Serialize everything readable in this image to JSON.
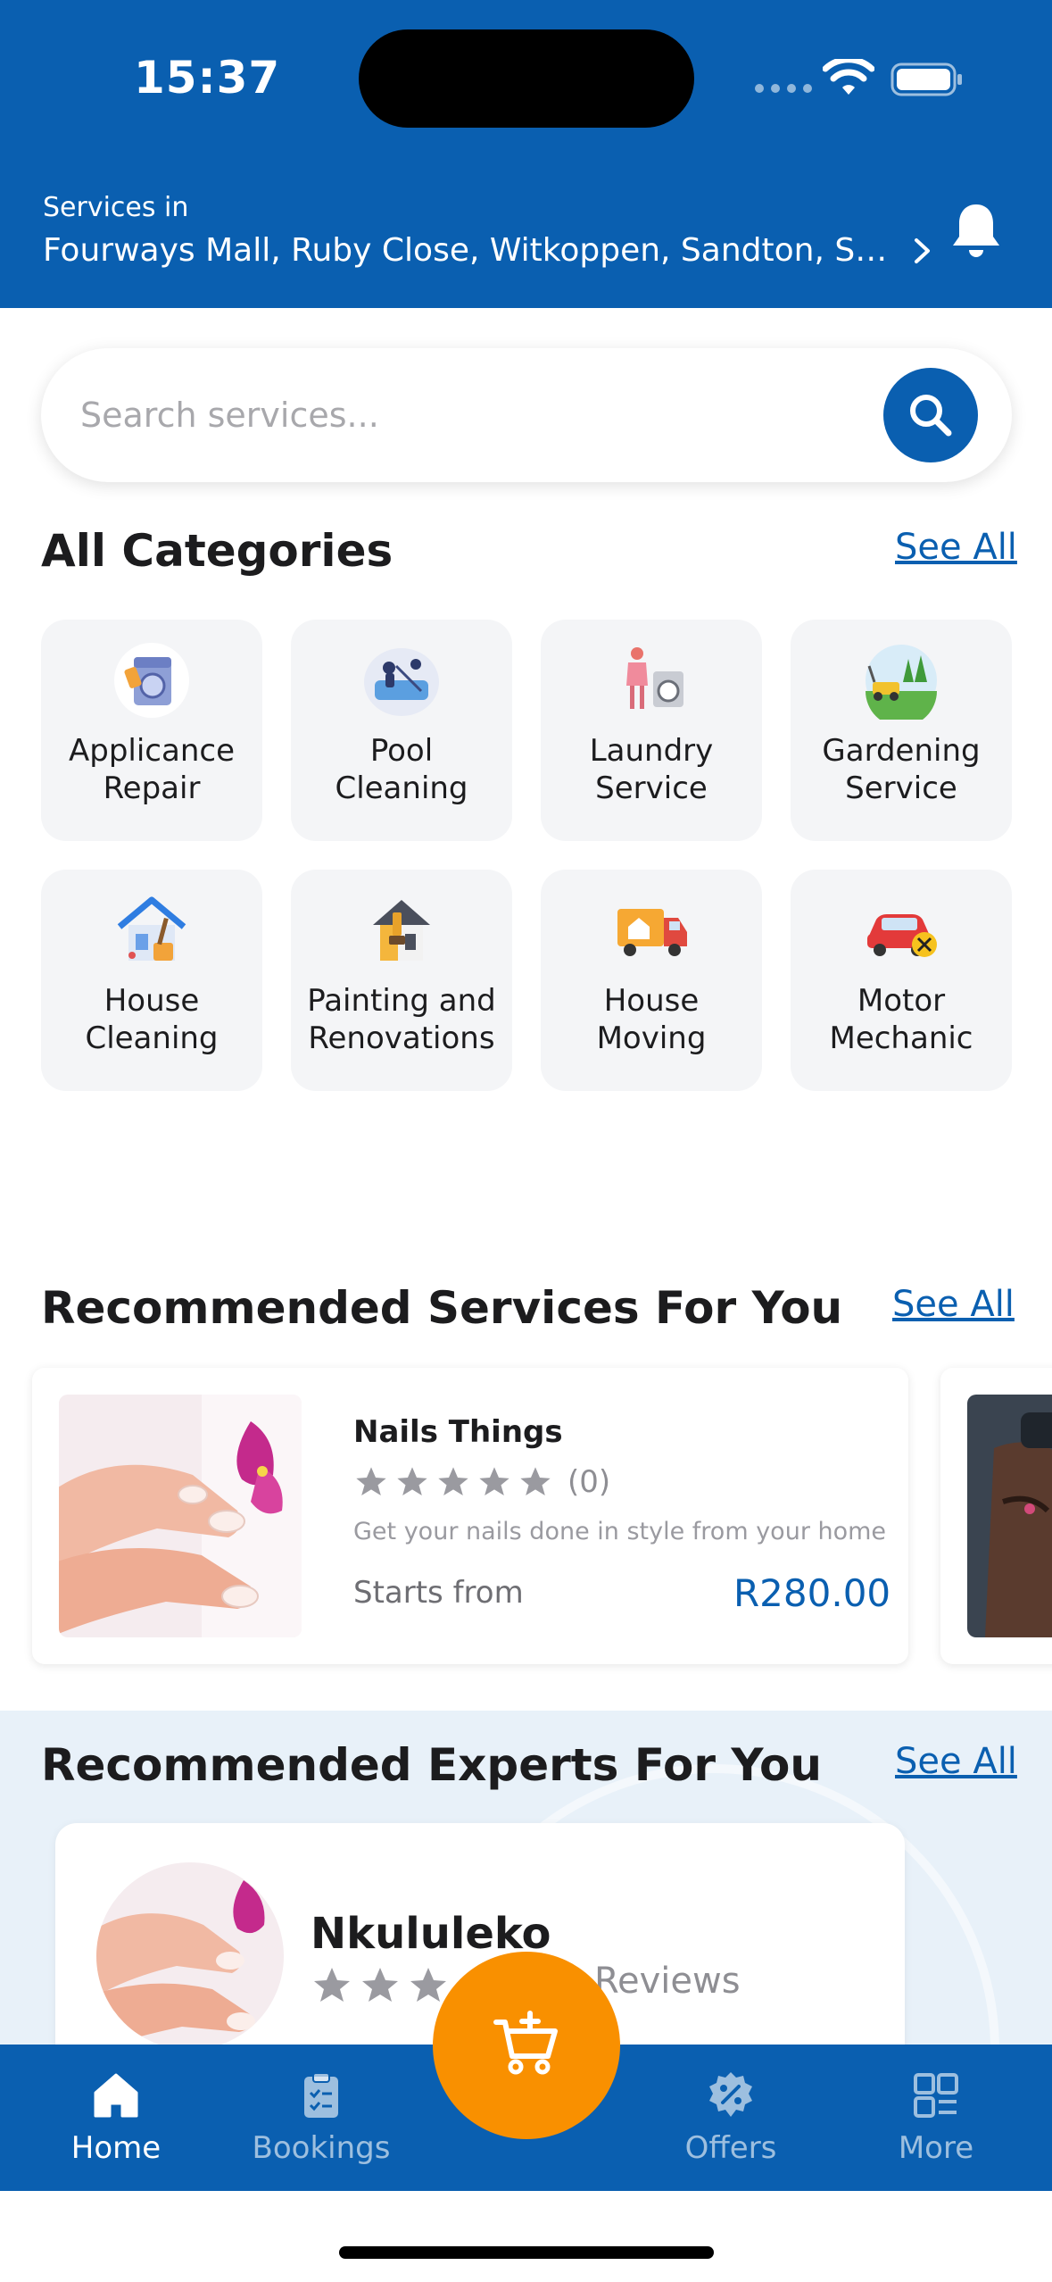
{
  "status_bar": {
    "time": "15:37"
  },
  "header": {
    "services_in_label": "Services in",
    "location": "Fourways Mall, Ruby Close, Witkoppen, Sandton, South A…"
  },
  "search": {
    "placeholder": "Search services..."
  },
  "categories": {
    "title": "All Categories",
    "see_all": "See All",
    "items": [
      {
        "label": "Applicance\nRepair",
        "icon": "appliance-repair-icon"
      },
      {
        "label": "Pool\nCleaning",
        "icon": "pool-cleaning-icon"
      },
      {
        "label": "Laundry\nService",
        "icon": "laundry-service-icon"
      },
      {
        "label": "Gardening\nService",
        "icon": "gardening-service-icon"
      },
      {
        "label": "House\nCleaning",
        "icon": "house-cleaning-icon"
      },
      {
        "label": "Painting and\nRenovations",
        "icon": "painting-renovations-icon"
      },
      {
        "label": "House\nMoving",
        "icon": "house-moving-icon"
      },
      {
        "label": "Motor\nMechanic",
        "icon": "motor-mechanic-icon"
      }
    ]
  },
  "recommended_services": {
    "title": "Recommended Services For You",
    "see_all": "See All",
    "items": [
      {
        "name": "Nails Things",
        "rating": 0,
        "review_count": "(0)",
        "description": "Get your nails done in style from your home",
        "starts_from_label": "Starts from",
        "price": "R280.00"
      }
    ]
  },
  "recommended_experts": {
    "title": "Recommended Experts For You",
    "see_all": "See All",
    "items": [
      {
        "name": "Nkululeko",
        "reviews_label": "Reviews"
      }
    ]
  },
  "tabbar": {
    "items": [
      {
        "label": "Home",
        "icon": "home-icon",
        "active": true
      },
      {
        "label": "Bookings",
        "icon": "clipboard-icon",
        "active": false
      },
      {
        "label": "Offers",
        "icon": "discount-badge-icon",
        "active": false
      },
      {
        "label": "More",
        "icon": "grid-icon",
        "active": false
      }
    ],
    "cart_icon": "cart-add-icon"
  },
  "colors": {
    "primary": "#0a5fb0",
    "accent": "#f99000",
    "card_bg": "#f4f5f7",
    "experts_bg": "#e8f1f9"
  }
}
